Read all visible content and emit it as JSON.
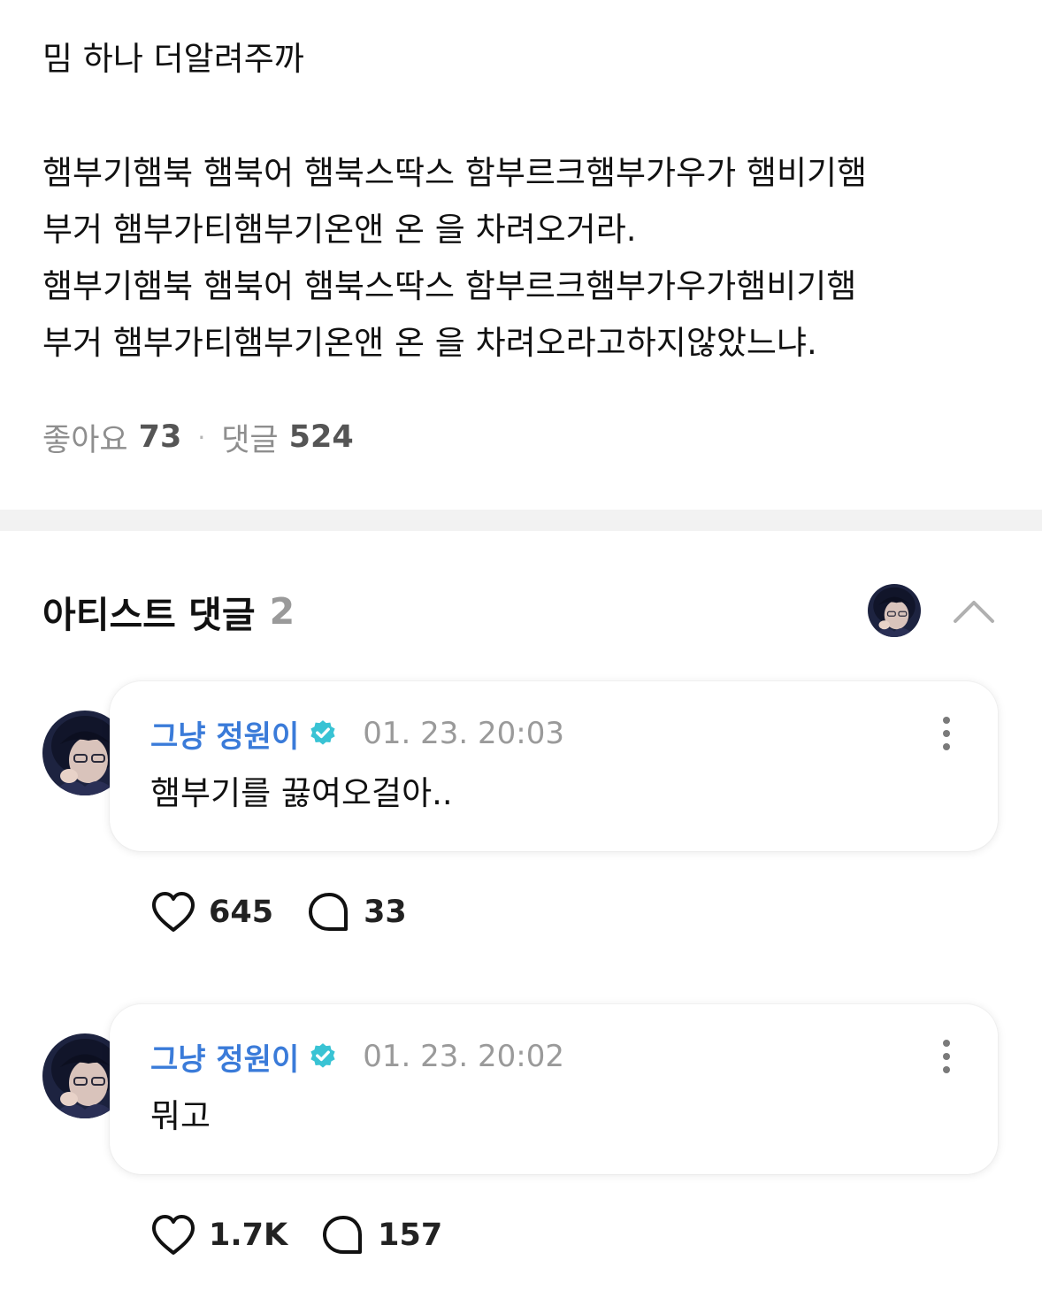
{
  "post": {
    "title": "밈 하나 더알려주까",
    "body_lines": [
      "햄부기햄북 햄북어 햄북스딱스 함부르크햄부가우가 햄비기햄",
      "부거 햄부가티햄부기온앤 온 을 차려오거라.",
      "햄부기햄북 햄북어 햄북스딱스 함부르크햄부가우가햄비기햄",
      "부거 햄부가티햄부기온앤 온 을 차려오라고하지않았느냐."
    ],
    "like_label": "좋아요",
    "like_count": "73",
    "separator": "·",
    "comment_label": "댓글",
    "comment_count": "524"
  },
  "artist_comments": {
    "title": "아티스트 댓글",
    "count": "2",
    "items": [
      {
        "author": "그냥 정원이",
        "time": "01. 23. 20:03",
        "text": "햄부기를 끓여오걸아..",
        "likes": "645",
        "replies": "33"
      },
      {
        "author": "그냥 정원이",
        "time": "01. 23. 20:02",
        "text": "뭐고",
        "likes": "1.7K",
        "replies": "157"
      }
    ]
  },
  "icons": {
    "verified": "verified-badge-icon",
    "more": "more-vertical-icon",
    "like": "heart-outline-icon",
    "reply": "speech-bubble-icon",
    "collapse": "chevron-up-icon"
  },
  "colors": {
    "author": "#3a7bd9",
    "verified_badge": "#39c3d4",
    "muted_text": "#9a9a9a",
    "divider": "#f2f2f2"
  }
}
